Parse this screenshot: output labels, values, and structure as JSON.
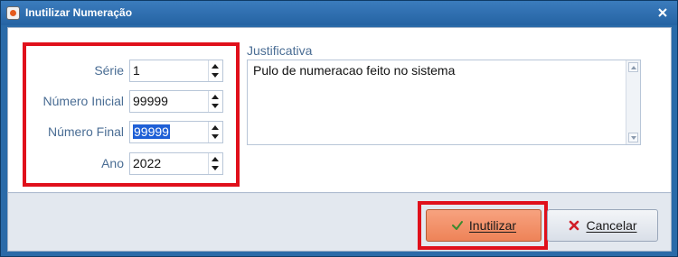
{
  "window": {
    "title": "Inutilizar Numeração"
  },
  "form": {
    "serie": {
      "label": "Série",
      "value": "1"
    },
    "numero_inicial": {
      "label": "Número Inicial",
      "value": "99999"
    },
    "numero_final": {
      "label": "Número Final",
      "value": "99999"
    },
    "ano": {
      "label": "Ano",
      "value": "2022"
    }
  },
  "justificativa": {
    "label": "Justificativa",
    "value": "Pulo de numeracao feito no sistema"
  },
  "buttons": {
    "inutilizar": "Inutilizar",
    "cancelar": "Cancelar"
  },
  "colors": {
    "highlight_box": "#e0101b",
    "primary_button": "#ee8358",
    "selection": "#1e5fd6"
  },
  "icons": {
    "app": "app-icon",
    "close": "close-icon",
    "confirm": "check-icon",
    "cancel": "x-icon"
  }
}
